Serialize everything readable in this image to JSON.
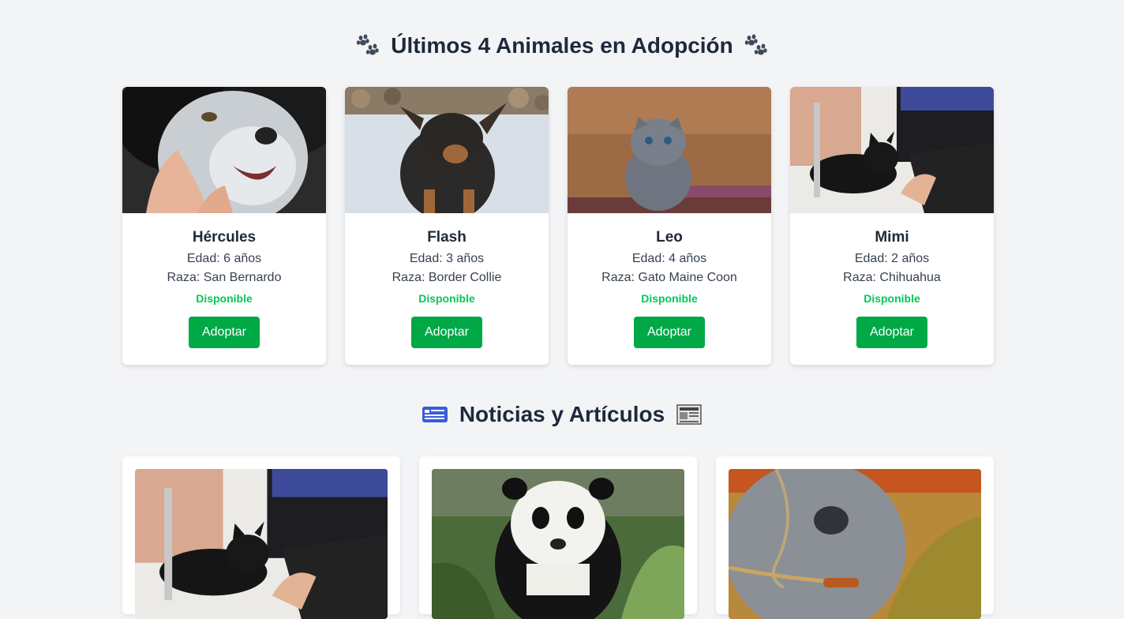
{
  "adoption": {
    "title": "Últimos 4 Animales en Adopción",
    "title_icon": "paw-prints-icon",
    "animals": [
      {
        "name": "Hércules",
        "age": "Edad: 6 años",
        "breed": "Raza: San Bernardo",
        "status": "Disponible",
        "button": "Adoptar",
        "photo": "dog-husky-photo"
      },
      {
        "name": "Flash",
        "age": "Edad: 3 años",
        "breed": "Raza: Border Collie",
        "status": "Disponible",
        "button": "Adoptar",
        "photo": "dog-puppy-photo"
      },
      {
        "name": "Leo",
        "age": "Edad: 4 años",
        "breed": "Raza: Gato Maine Coon",
        "status": "Disponible",
        "button": "Adoptar",
        "photo": "gray-kitten-photo"
      },
      {
        "name": "Mimi",
        "age": "Edad: 2 años",
        "breed": "Raza: Chihuahua",
        "status": "Disponible",
        "button": "Adoptar",
        "photo": "black-kitten-photo"
      }
    ]
  },
  "news": {
    "title": "Noticias y Artículos",
    "left_icon": "newspaper-blue-icon",
    "right_icon": "newspaper-icon",
    "articles": [
      {
        "photo": "black-kitten-keyboard-photo"
      },
      {
        "photo": "panda-photo"
      },
      {
        "photo": "cow-photo"
      }
    ]
  },
  "colors": {
    "background": "#f3f4f6",
    "button": "#00a846",
    "status": "#00c853",
    "title": "#1e293b"
  }
}
